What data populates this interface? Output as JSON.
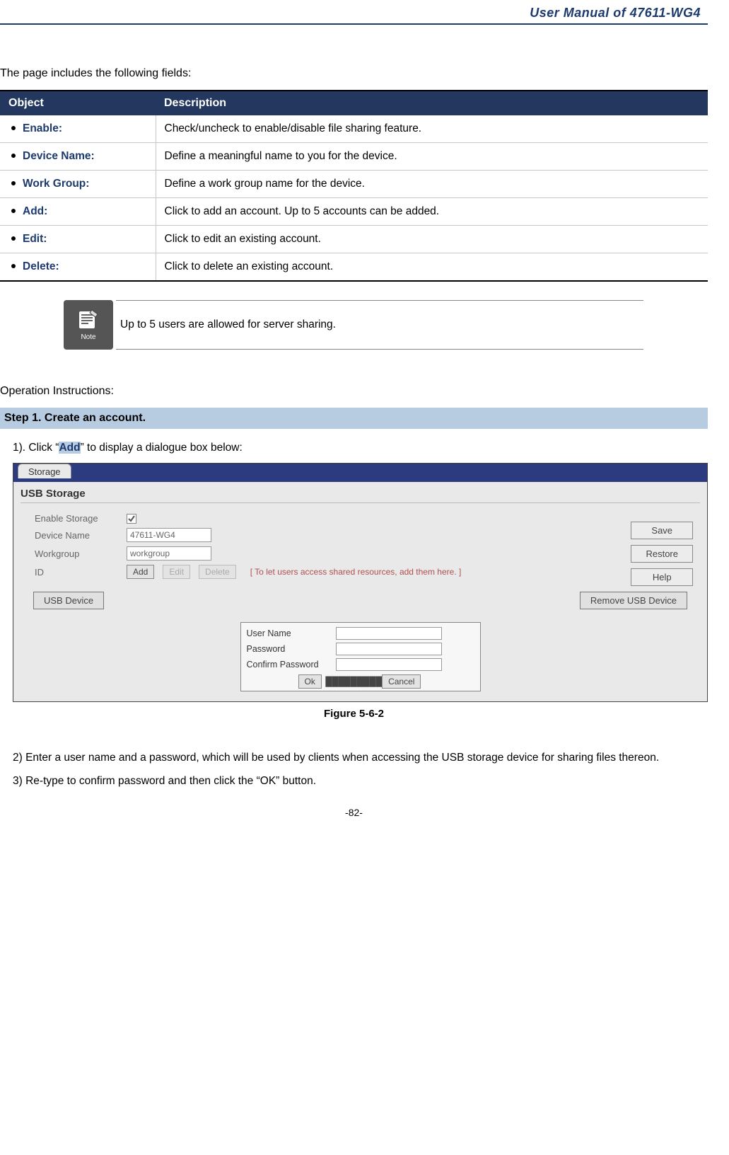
{
  "header": {
    "title": "User Manual of 47611-WG4"
  },
  "intro": "The page includes the following fields:",
  "table": {
    "headers": {
      "object": "Object",
      "description": "Description"
    },
    "rows": [
      {
        "object": "Enable:",
        "description": "Check/uncheck to enable/disable file sharing feature."
      },
      {
        "object": "Device Name:",
        "description": "Define a meaningful name to you for the device."
      },
      {
        "object": "Work Group:",
        "description": "Define a work group name for the device."
      },
      {
        "object": "Add:",
        "description": "Click to add an account. Up to 5 accounts can be added."
      },
      {
        "object": "Edit:",
        "description": "Click to edit an existing account."
      },
      {
        "object": "Delete:",
        "description": "Click to delete an existing account."
      }
    ]
  },
  "note": {
    "icon_label": "Note",
    "text": "Up to 5 users are allowed for server sharing."
  },
  "operation": {
    "heading": "Operation Instructions:",
    "step_title": "Step 1.   Create an account.",
    "line1_prefix": "1). Click “",
    "line1_highlight": "Add",
    "line1_suffix": "” to display a dialogue box below:"
  },
  "screenshot": {
    "tab": "Storage",
    "panel_title": "USB Storage",
    "labels": {
      "enable": "Enable Storage",
      "device": "Device Name",
      "workgroup": "Workgroup",
      "id": "ID"
    },
    "values": {
      "device": "47611-WG4",
      "workgroup": "workgroup"
    },
    "buttons": {
      "add": "Add",
      "edit": "Edit",
      "delete": "Delete",
      "save": "Save",
      "restore": "Restore",
      "help": "Help",
      "usb_device": "USB Device",
      "remove_usb": "Remove USB Device",
      "ok": "Ok",
      "cancel": "Cancel"
    },
    "hint": "[ To let users access shared resources, add them here. ]",
    "dialog": {
      "user": "User Name",
      "password": "Password",
      "confirm": "Confirm Password"
    }
  },
  "caption": "Figure 5-6-2",
  "after": {
    "step2": "2) Enter a user name and a password, which will be used by clients when accessing the USB storage device for sharing files thereon.",
    "step3": "3) Re-type to confirm password and then click the “OK” button."
  },
  "footer": "-82-"
}
